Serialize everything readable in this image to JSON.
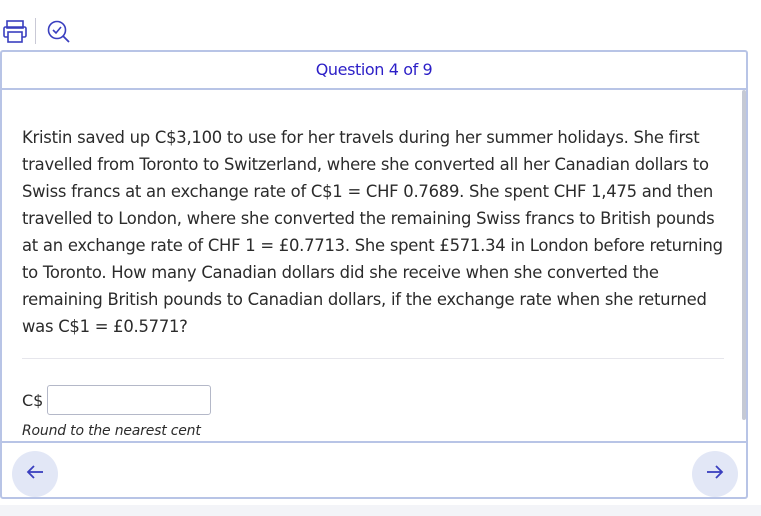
{
  "toolbar": {
    "print_icon": "print-icon",
    "check_icon": "check-answer-icon"
  },
  "header": {
    "question_counter": "Question 4 of 9"
  },
  "question": {
    "text": "Kristin saved up C$3,100 to use for her travels during her summer holidays. She first travelled from Toronto to Switzerland, where she converted all her Canadian dollars to Swiss francs at an exchange rate of C$1 = CHF 0.7689. She spent CHF 1,475 and then travelled to London, where she converted the remaining Swiss francs to British pounds at an exchange rate of CHF 1 = £0.7713. She spent £571.34 in London before returning to Toronto. How many Canadian dollars did she receive when she converted the remaining British pounds to Canadian dollars, if the exchange rate when she returned was C$1 = £0.5771?"
  },
  "answer": {
    "currency_label": "C$",
    "value": "",
    "placeholder": "",
    "hint": "Round to the nearest cent"
  },
  "navigation": {
    "prev_icon": "arrow-left-icon",
    "next_icon": "arrow-right-icon"
  },
  "colors": {
    "accent": "#2c1fc7",
    "frame_border": "#b8c4e6",
    "nav_button_bg": "#e2e7f6",
    "icon_color": "#3a3fbf"
  }
}
